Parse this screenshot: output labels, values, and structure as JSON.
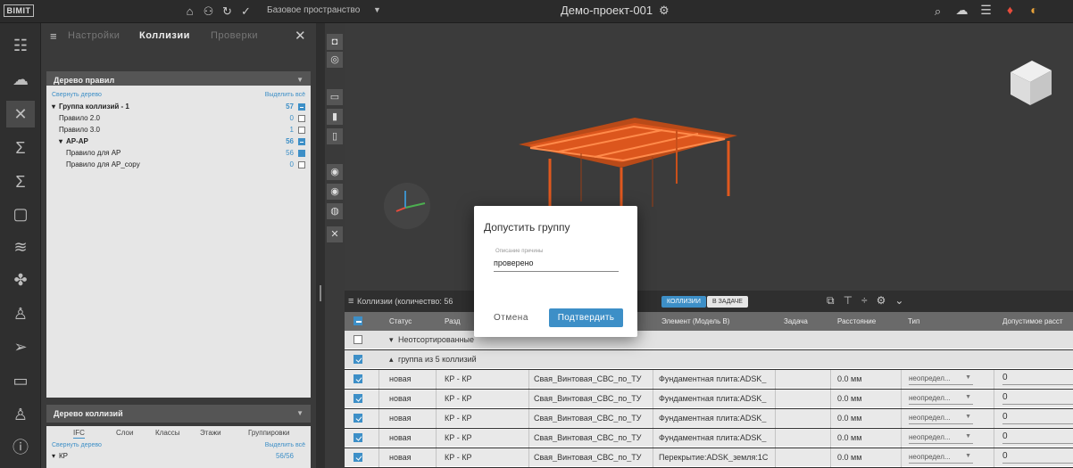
{
  "app": {
    "logo": "BIMIT",
    "space": "Базовое пространство",
    "project": "Демо-проект-001"
  },
  "rules_panel": {
    "tabs": [
      "Настройки",
      "Коллизии",
      "Проверки"
    ],
    "active_tab": "Коллизии",
    "rules_tree_title": "Дерево правил",
    "collapse_tree": "Свернуть дерево",
    "select_all": "Выделить всё",
    "rules": [
      {
        "label": "Группа коллизий - 1",
        "count": "57",
        "checked": "partial",
        "bold": true,
        "caret": true
      },
      {
        "label": "Правило 2.0",
        "count": "0",
        "checked": "off",
        "bold": false,
        "caret": false
      },
      {
        "label": "Правило 3.0",
        "count": "1",
        "checked": "off",
        "bold": false,
        "caret": false
      },
      {
        "label": "АР-АР",
        "count": "56",
        "checked": "partial",
        "bold": true,
        "caret": true
      },
      {
        "label": "Правило для АР",
        "count": "56",
        "checked": "on",
        "bold": false,
        "caret": false
      },
      {
        "label": "Правило для АР_copy",
        "count": "0",
        "checked": "off",
        "bold": false,
        "caret": false
      }
    ],
    "collision_tree_title": "Дерево коллизий",
    "collision_tabs": [
      "IFC",
      "Слои",
      "Классы",
      "Этажи",
      "Группировки"
    ],
    "collision_tree_first": "КР",
    "collision_tree_first_count": "56/56"
  },
  "collisions_table": {
    "title": "Коллизии (количество: 56",
    "pill_collisions": "КОЛЛИЗИИ",
    "pill_task": "В ЗАДАЧЕ",
    "columns": [
      "Статус",
      "Разд",
      "Элемент (Модель В)",
      "Задача",
      "Расстояние",
      "Тип",
      "Допустимое расст"
    ],
    "group_unsorted": "Неотсортированные",
    "group_five": "группа из 5 коллизий",
    "rows": [
      {
        "status": "новая",
        "section": "КР - КР",
        "element_a": "Свая_Винтовая_СВС_по_ТУ",
        "element_b": "Фундаментная плита:ADSK_",
        "distance": "0.0 мм",
        "type": "неопредел...",
        "allowed": "0"
      },
      {
        "status": "новая",
        "section": "КР - КР",
        "element_a": "Свая_Винтовая_СВС_по_ТУ",
        "element_b": "Фундаментная плита:ADSK_",
        "distance": "0.0 мм",
        "type": "неопредел...",
        "allowed": "0"
      },
      {
        "status": "новая",
        "section": "КР - КР",
        "element_a": "Свая_Винтовая_СВС_по_ТУ",
        "element_b": "Фундаментная плита:ADSK_",
        "distance": "0.0 мм",
        "type": "неопредел...",
        "allowed": "0"
      },
      {
        "status": "новая",
        "section": "КР - КР",
        "element_a": "Свая_Винтовая_СВС_по_ТУ",
        "element_b": "Фундаментная плита:ADSK_",
        "distance": "0.0 мм",
        "type": "неопредел...",
        "allowed": "0"
      },
      {
        "status": "новая",
        "section": "КР - КР",
        "element_a": "Свая_Винтовая_СВС_по_ТУ",
        "element_b": "Перекрытие:ADSK_земля:1С",
        "distance": "0.0 мм",
        "type": "неопредел...",
        "allowed": "0"
      }
    ]
  },
  "dialog": {
    "title": "Допустить группу",
    "field_label": "Описание причины",
    "field_value": "проверено",
    "cancel": "Отмена",
    "confirm": "Подтвердить"
  },
  "colors": {
    "accent": "#3d8fc7",
    "model": "#e0581e"
  }
}
